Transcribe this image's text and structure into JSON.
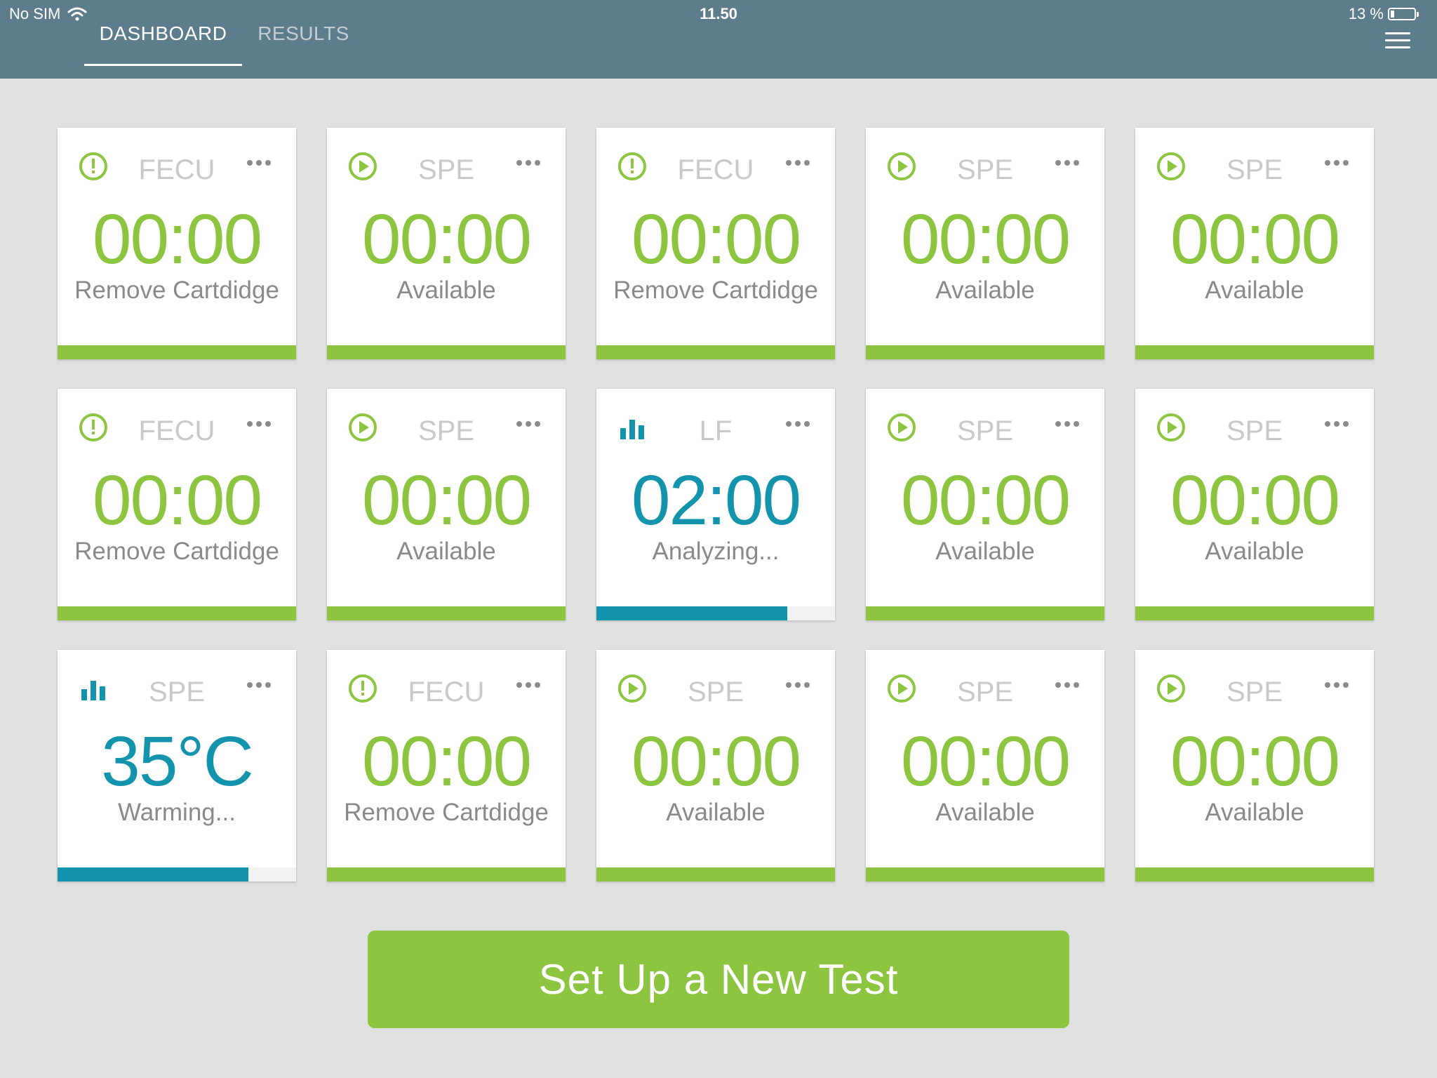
{
  "status_bar": {
    "carrier": "No SIM",
    "time": "11.50",
    "battery": "13 %",
    "battery_level": 0.13
  },
  "tabs": [
    {
      "label": "DASHBOARD",
      "active": true
    },
    {
      "label": "RESULTS",
      "active": false
    }
  ],
  "colors": {
    "header": "#5e7d8c",
    "accent_green": "#8dc540",
    "accent_blue": "#1493ad",
    "background": "#e0e0e0"
  },
  "cards": [
    {
      "icon": "alert-icon",
      "type": "FECU",
      "time": "00:00",
      "status": "Remove Cartdidge",
      "color": "green",
      "progress": 1.0
    },
    {
      "icon": "play-icon",
      "type": "SPE",
      "time": "00:00",
      "status": "Available",
      "color": "green",
      "progress": 1.0
    },
    {
      "icon": "alert-icon",
      "type": "FECU",
      "time": "00:00",
      "status": "Remove Cartdidge",
      "color": "green",
      "progress": 1.0
    },
    {
      "icon": "play-icon",
      "type": "SPE",
      "time": "00:00",
      "status": "Available",
      "color": "green",
      "progress": 1.0
    },
    {
      "icon": "play-icon",
      "type": "SPE",
      "time": "00:00",
      "status": "Available",
      "color": "green",
      "progress": 1.0
    },
    {
      "icon": "alert-icon",
      "type": "FECU",
      "time": "00:00",
      "status": "Remove Cartdidge",
      "color": "green",
      "progress": 1.0
    },
    {
      "icon": "play-icon",
      "type": "SPE",
      "time": "00:00",
      "status": "Available",
      "color": "green",
      "progress": 1.0
    },
    {
      "icon": "bar-chart-icon",
      "type": "LF",
      "time": "02:00",
      "status": "Analyzing...",
      "color": "blue",
      "progress": 0.8
    },
    {
      "icon": "play-icon",
      "type": "SPE",
      "time": "00:00",
      "status": "Available",
      "color": "green",
      "progress": 1.0
    },
    {
      "icon": "play-icon",
      "type": "SPE",
      "time": "00:00",
      "status": "Available",
      "color": "green",
      "progress": 1.0
    },
    {
      "icon": "bar-chart-icon",
      "type": "SPE",
      "time": "35°C",
      "status": "Warming...",
      "color": "blue",
      "progress": 0.8
    },
    {
      "icon": "alert-icon",
      "type": "FECU",
      "time": "00:00",
      "status": "Remove Cartdidge",
      "color": "green",
      "progress": 1.0
    },
    {
      "icon": "play-icon",
      "type": "SPE",
      "time": "00:00",
      "status": "Available",
      "color": "green",
      "progress": 1.0
    },
    {
      "icon": "play-icon",
      "type": "SPE",
      "time": "00:00",
      "status": "Available",
      "color": "green",
      "progress": 1.0
    },
    {
      "icon": "play-icon",
      "type": "SPE",
      "time": "00:00",
      "status": "Available",
      "color": "green",
      "progress": 1.0
    }
  ],
  "new_test_button": "Set Up a New Test"
}
